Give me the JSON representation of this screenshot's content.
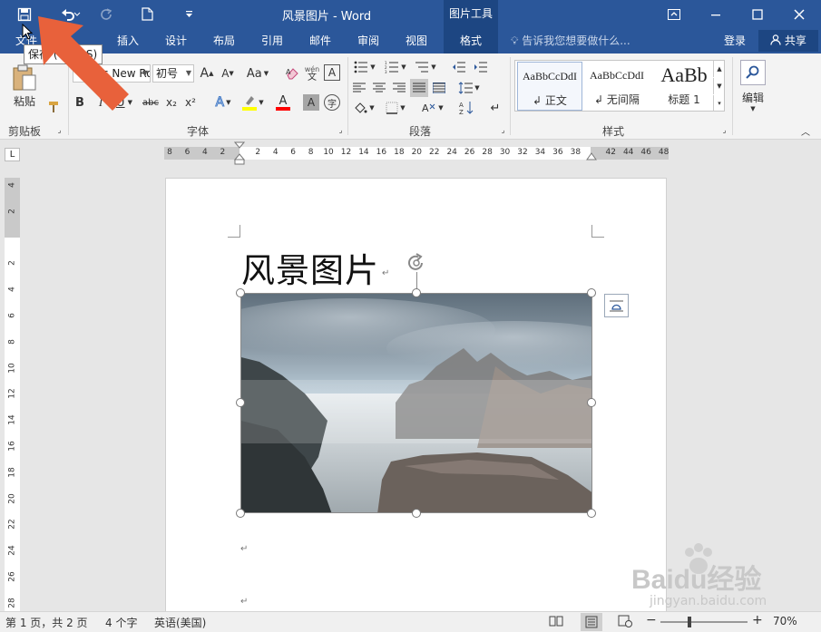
{
  "titlebar": {
    "doc_title": "风景图片 - Word",
    "context_tab_header": "图片工具"
  },
  "tabs": {
    "file": "文件",
    "insert": "插入",
    "design": "设计",
    "layout": "布局",
    "references": "引用",
    "mailings": "邮件",
    "review": "审阅",
    "view": "视图",
    "format": "格式"
  },
  "tell_me": "告诉我您想要做什么...",
  "account": {
    "login": "登录",
    "share": "共享"
  },
  "ribbon": {
    "clipboard": {
      "label": "剪贴板",
      "paste": "粘贴"
    },
    "font": {
      "label": "字体",
      "font_name": "Times New Roman (西",
      "font_size": "初号",
      "bold": "B",
      "italic": "I",
      "underline": "U",
      "strike": "abc",
      "sub": "x₂",
      "sup": "x²",
      "grow": "A",
      "shrink": "A",
      "change_case": "Aa",
      "phonetic_top": "wén",
      "phonetic_bottom": "文",
      "char_border": "A",
      "text_effects": "A",
      "font_color": "A",
      "char_shading": "A",
      "enclose": "字"
    },
    "paragraph": {
      "label": "段落"
    },
    "styles": {
      "label": "样式",
      "items": [
        {
          "preview": "AaBbCcDdI",
          "name": "正文"
        },
        {
          "preview": "AaBbCcDdI",
          "name": "无间隔"
        },
        {
          "preview": "AaBb",
          "name": "标题 1"
        }
      ]
    },
    "editing": {
      "label": "编辑"
    }
  },
  "tooltip": "保存 (Ctrl+S)",
  "ruler": {
    "h_ticks": [
      "8",
      "6",
      "4",
      "2",
      "",
      "2",
      "4",
      "6",
      "8",
      "10",
      "12",
      "14",
      "16",
      "18",
      "20",
      "22",
      "24",
      "26",
      "28",
      "30",
      "32",
      "34",
      "36",
      "38",
      "",
      "42",
      "44",
      "46",
      "48"
    ],
    "v_ticks": [
      "4",
      "2",
      "",
      "2",
      "4",
      "6",
      "8",
      "10",
      "12",
      "14",
      "16",
      "18",
      "20",
      "22",
      "24",
      "26",
      "28"
    ],
    "corner": "L"
  },
  "document": {
    "heading": "风景图片",
    "para_mark": "↵"
  },
  "statusbar": {
    "page_info": "第 1 页，共 2 页",
    "word_count": "4 个字",
    "language": "英语(美国)",
    "zoom": "70%",
    "zoom_out": "−",
    "zoom_in": "+"
  },
  "watermark": {
    "brand": "Baidu经验",
    "url": "jingyan.baidu.com"
  },
  "colors": {
    "title_bar": "#2b579a",
    "context_tab": "#1d4682",
    "pointer_arrow": "#e8613b",
    "highlight_yellow": "#ffff00",
    "font_red": "#ff0000"
  },
  "icons": [
    "save-icon",
    "undo-icon",
    "redo-icon",
    "new-doc-icon",
    "customize-icon",
    "ribbon-display-icon",
    "minimize-icon",
    "maximize-icon",
    "close-icon",
    "lightbulb-icon",
    "person-icon",
    "rotate-handle-icon",
    "layout-options-icon",
    "read-mode-icon",
    "print-layout-icon",
    "web-layout-icon"
  ]
}
